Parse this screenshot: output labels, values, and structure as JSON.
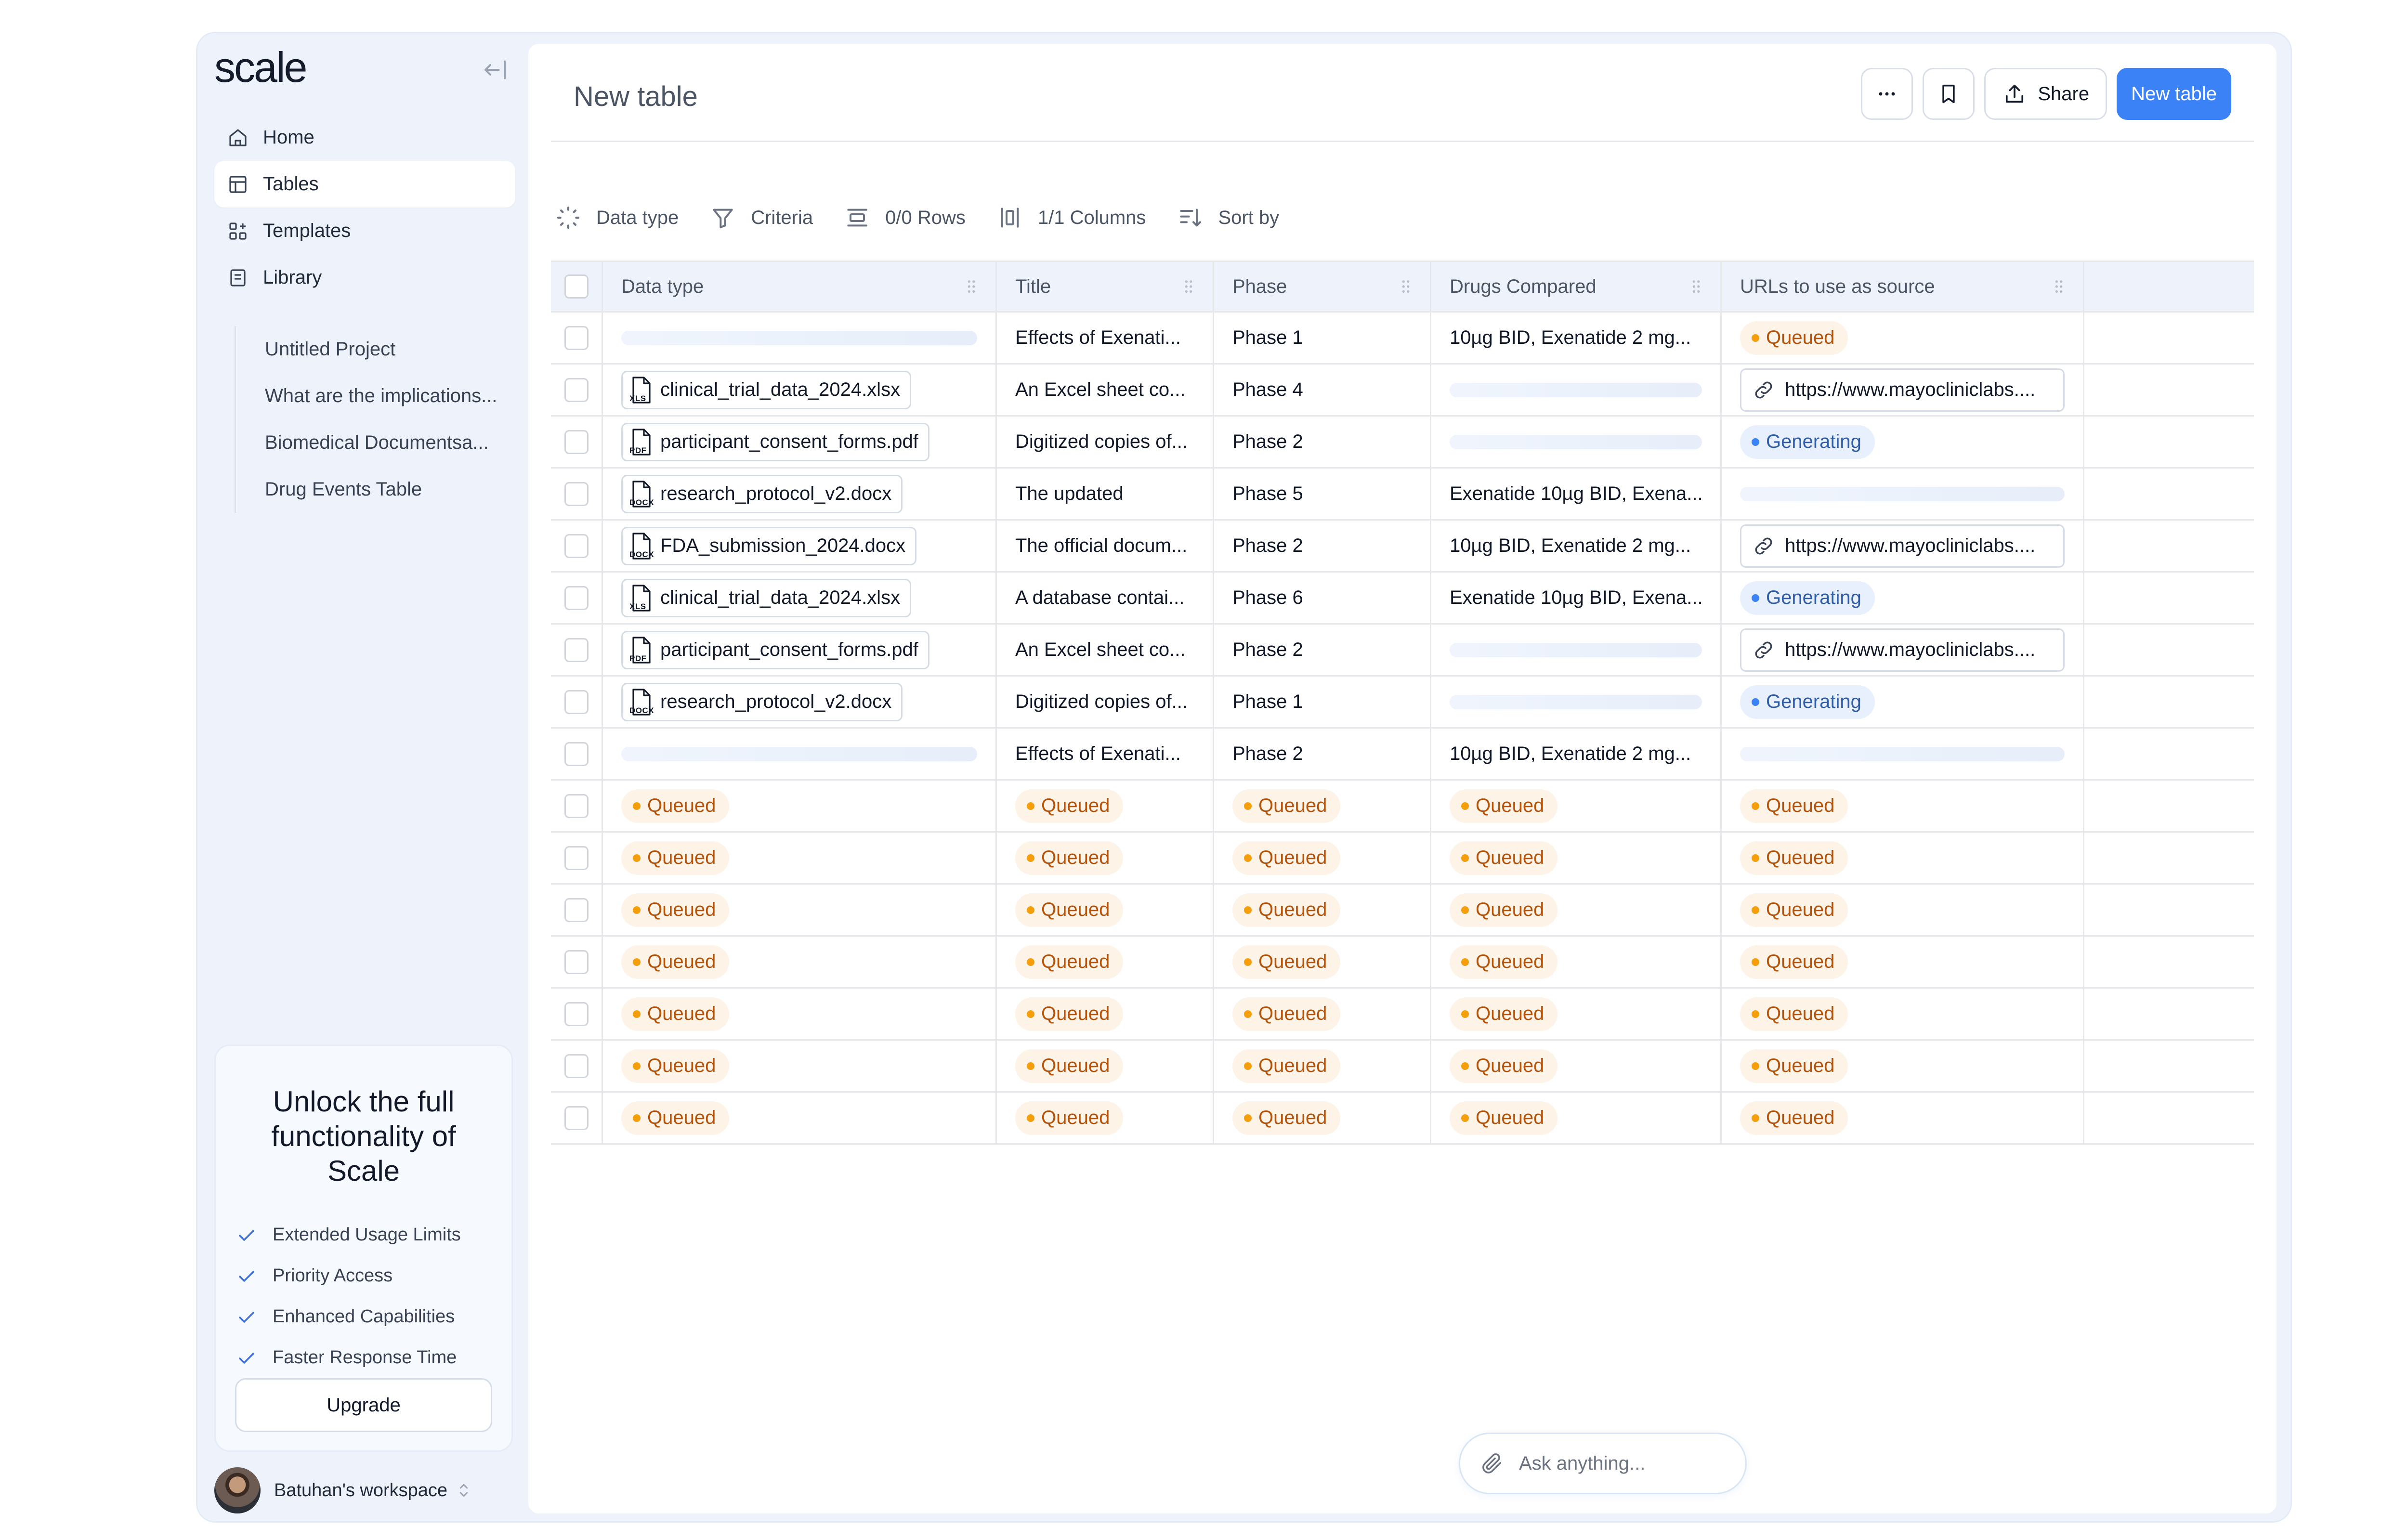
{
  "app": {
    "logo": "scale"
  },
  "sidebar": {
    "nav": [
      {
        "label": "Home",
        "icon": "home-icon",
        "active": false
      },
      {
        "label": "Tables",
        "icon": "table-icon",
        "active": true
      },
      {
        "label": "Templates",
        "icon": "templates-icon",
        "active": false
      },
      {
        "label": "Library",
        "icon": "library-icon",
        "active": false
      }
    ],
    "library_items": [
      "Untitled Project",
      "What are the implications...",
      "Biomedical Documentsa...",
      "Drug Events Table"
    ],
    "upgrade": {
      "title": "Unlock the full functionality of Scale",
      "features": [
        "Extended Usage Limits",
        "Priority Access",
        "Enhanced Capabilities",
        "Faster Response Time"
      ],
      "button": "Upgrade"
    },
    "workspace": "Batuhan's workspace"
  },
  "main": {
    "title": "New table",
    "share_label": "Share",
    "new_table_label": "New table",
    "toolbar": {
      "data_type": "Data type",
      "criteria": "Criteria",
      "rows": "0/0 Rows",
      "columns": "1/1 Columns",
      "sort": "Sort by"
    },
    "ask_placeholder": "Ask anything...",
    "columns": [
      "Data type",
      "Title",
      "Phase",
      "Drugs Compared",
      "URLs to use as source"
    ]
  },
  "table": {
    "rows": [
      {
        "data_type": {
          "kind": "skeleton"
        },
        "title": {
          "kind": "text",
          "value": "Effects of Exenati..."
        },
        "phase": {
          "kind": "text",
          "value": "Phase 1"
        },
        "drugs": {
          "kind": "text",
          "value": "10µg BID, Exenatide 2 mg..."
        },
        "url": {
          "kind": "status",
          "value": "Queued",
          "variant": "queued"
        }
      },
      {
        "data_type": {
          "kind": "file",
          "value": "clinical_trial_data_2024.xlsx",
          "ext": "XLS"
        },
        "title": {
          "kind": "text",
          "value": "An Excel sheet co..."
        },
        "phase": {
          "kind": "text",
          "value": "Phase 4"
        },
        "drugs": {
          "kind": "skeleton"
        },
        "url": {
          "kind": "url",
          "value": "https://www.mayocliniclabs...."
        }
      },
      {
        "data_type": {
          "kind": "file",
          "value": "participant_consent_forms.pdf",
          "ext": "PDF"
        },
        "title": {
          "kind": "text",
          "value": "Digitized copies of..."
        },
        "phase": {
          "kind": "text",
          "value": "Phase 2"
        },
        "drugs": {
          "kind": "skeleton"
        },
        "url": {
          "kind": "status",
          "value": "Generating",
          "variant": "generating"
        }
      },
      {
        "data_type": {
          "kind": "file",
          "value": "research_protocol_v2.docx",
          "ext": "DOCX"
        },
        "title": {
          "kind": "text",
          "value": "The updated"
        },
        "phase": {
          "kind": "text",
          "value": "Phase 5"
        },
        "drugs": {
          "kind": "text",
          "value": "Exenatide 10µg BID, Exena..."
        },
        "url": {
          "kind": "skeleton"
        }
      },
      {
        "data_type": {
          "kind": "file",
          "value": "FDA_submission_2024.docx",
          "ext": "DOCX"
        },
        "title": {
          "kind": "text",
          "value": "The official docum..."
        },
        "phase": {
          "kind": "text",
          "value": "Phase 2"
        },
        "drugs": {
          "kind": "text",
          "value": "10µg BID, Exenatide 2 mg..."
        },
        "url": {
          "kind": "url",
          "value": "https://www.mayocliniclabs...."
        }
      },
      {
        "data_type": {
          "kind": "file",
          "value": "clinical_trial_data_2024.xlsx",
          "ext": "XLS"
        },
        "title": {
          "kind": "text",
          "value": "A database contai..."
        },
        "phase": {
          "kind": "text",
          "value": "Phase 6"
        },
        "drugs": {
          "kind": "text",
          "value": "Exenatide 10µg BID, Exena..."
        },
        "url": {
          "kind": "status",
          "value": "Generating",
          "variant": "generating"
        }
      },
      {
        "data_type": {
          "kind": "file",
          "value": "participant_consent_forms.pdf",
          "ext": "PDF"
        },
        "title": {
          "kind": "text",
          "value": "An Excel sheet co..."
        },
        "phase": {
          "kind": "text",
          "value": "Phase 2"
        },
        "drugs": {
          "kind": "skeleton"
        },
        "url": {
          "kind": "url",
          "value": "https://www.mayocliniclabs...."
        }
      },
      {
        "data_type": {
          "kind": "file",
          "value": "research_protocol_v2.docx",
          "ext": "DOCX"
        },
        "title": {
          "kind": "text",
          "value": "Digitized copies of..."
        },
        "phase": {
          "kind": "text",
          "value": "Phase 1"
        },
        "drugs": {
          "kind": "skeleton"
        },
        "url": {
          "kind": "status",
          "value": "Generating",
          "variant": "generating"
        }
      },
      {
        "data_type": {
          "kind": "skeleton"
        },
        "title": {
          "kind": "text",
          "value": "Effects of Exenati..."
        },
        "phase": {
          "kind": "text",
          "value": "Phase 2"
        },
        "drugs": {
          "kind": "text",
          "value": "10µg BID, Exenatide 2 mg..."
        },
        "url": {
          "kind": "skeleton"
        }
      },
      {
        "data_type": {
          "kind": "status",
          "value": "Queued",
          "variant": "queued"
        },
        "title": {
          "kind": "status",
          "value": "Queued",
          "variant": "queued"
        },
        "phase": {
          "kind": "status",
          "value": "Queued",
          "variant": "queued"
        },
        "drugs": {
          "kind": "status",
          "value": "Queued",
          "variant": "queued"
        },
        "url": {
          "kind": "status",
          "value": "Queued",
          "variant": "queued"
        }
      },
      {
        "data_type": {
          "kind": "status",
          "value": "Queued",
          "variant": "queued"
        },
        "title": {
          "kind": "status",
          "value": "Queued",
          "variant": "queued"
        },
        "phase": {
          "kind": "status",
          "value": "Queued",
          "variant": "queued"
        },
        "drugs": {
          "kind": "status",
          "value": "Queued",
          "variant": "queued"
        },
        "url": {
          "kind": "status",
          "value": "Queued",
          "variant": "queued"
        }
      },
      {
        "data_type": {
          "kind": "status",
          "value": "Queued",
          "variant": "queued"
        },
        "title": {
          "kind": "status",
          "value": "Queued",
          "variant": "queued"
        },
        "phase": {
          "kind": "status",
          "value": "Queued",
          "variant": "queued"
        },
        "drugs": {
          "kind": "status",
          "value": "Queued",
          "variant": "queued"
        },
        "url": {
          "kind": "status",
          "value": "Queued",
          "variant": "queued"
        }
      },
      {
        "data_type": {
          "kind": "status",
          "value": "Queued",
          "variant": "queued"
        },
        "title": {
          "kind": "status",
          "value": "Queued",
          "variant": "queued"
        },
        "phase": {
          "kind": "status",
          "value": "Queued",
          "variant": "queued"
        },
        "drugs": {
          "kind": "status",
          "value": "Queued",
          "variant": "queued"
        },
        "url": {
          "kind": "status",
          "value": "Queued",
          "variant": "queued"
        }
      },
      {
        "data_type": {
          "kind": "status",
          "value": "Queued",
          "variant": "queued"
        },
        "title": {
          "kind": "status",
          "value": "Queued",
          "variant": "queued"
        },
        "phase": {
          "kind": "status",
          "value": "Queued",
          "variant": "queued"
        },
        "drugs": {
          "kind": "status",
          "value": "Queued",
          "variant": "queued"
        },
        "url": {
          "kind": "status",
          "value": "Queued",
          "variant": "queued"
        }
      },
      {
        "data_type": {
          "kind": "status",
          "value": "Queued",
          "variant": "queued"
        },
        "title": {
          "kind": "status",
          "value": "Queued",
          "variant": "queued"
        },
        "phase": {
          "kind": "status",
          "value": "Queued",
          "variant": "queued"
        },
        "drugs": {
          "kind": "status",
          "value": "Queued",
          "variant": "queued"
        },
        "url": {
          "kind": "status",
          "value": "Queued",
          "variant": "queued"
        }
      },
      {
        "data_type": {
          "kind": "status",
          "value": "Queued",
          "variant": "queued"
        },
        "title": {
          "kind": "status",
          "value": "Queued",
          "variant": "queued"
        },
        "phase": {
          "kind": "status",
          "value": "Queued",
          "variant": "queued"
        },
        "drugs": {
          "kind": "status",
          "value": "Queued",
          "variant": "queued"
        },
        "url": {
          "kind": "status",
          "value": "Queued",
          "variant": "queued"
        }
      }
    ]
  }
}
